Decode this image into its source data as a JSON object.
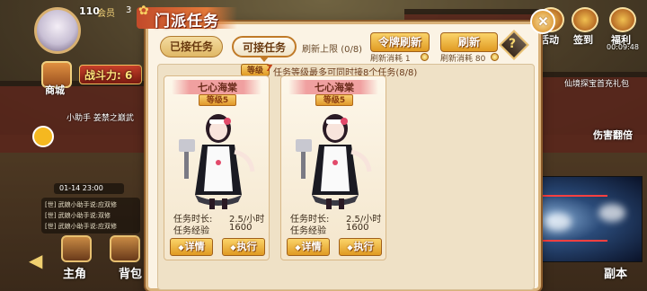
{
  "dialog": {
    "title": "门派任务",
    "tabs": {
      "accepted": "已接任务",
      "available": "可接任务"
    },
    "refresh_limit_label": "刷新上限",
    "refresh_limit_value": "(0/8)",
    "token_refresh": {
      "label": "令牌刷新",
      "cost_label": "刷新消耗",
      "cost": "1"
    },
    "normal_refresh": {
      "label": "刷新",
      "cost_label": "刷新消耗",
      "cost": "80"
    },
    "level_label": "等级",
    "level_value": "7",
    "task_note": "任务等级最多可同时接8个任务(8/8)",
    "tasks": [
      {
        "name": "七心海棠",
        "level": "等级5",
        "duration_label": "任务时长:",
        "duration": "2.5/小时",
        "exp_label": "任务经验",
        "exp": "1600",
        "detail_button": "详情",
        "execute_button": "执行"
      },
      {
        "name": "七心海棠",
        "level": "等级5",
        "duration_label": "任务时长:",
        "duration": "2.5/小时",
        "exp_label": "任务经验",
        "exp": "1600",
        "detail_button": "详情",
        "execute_button": "执行"
      }
    ]
  },
  "hud": {
    "player_level": "110",
    "vip_label": "会员",
    "vip_level": "3",
    "power_label": "战斗力: 6",
    "mall_label": "商城",
    "assistant_text": "小助手   姜禁之巅武",
    "timestamp": "01-14 23:00",
    "chat_lines": [
      "[世] 武娘小助手说:应双修",
      "[世] 武娘小助手说:双修",
      "[世] 武娘小助手说:应双修"
    ],
    "nav": {
      "main_role": "主角",
      "backpack": "背包",
      "dungeon": "副本"
    },
    "right": {
      "activity": "活动",
      "sign_in": "签到",
      "welfare": "福利",
      "timer": "00:09:48"
    },
    "side_text": "仙境探宝首充礼包",
    "damage_text": "伤害翻倍"
  },
  "colors": {
    "accent": "#e09a22",
    "title_red": "#c24a2a",
    "paper": "#fbf3e4"
  }
}
